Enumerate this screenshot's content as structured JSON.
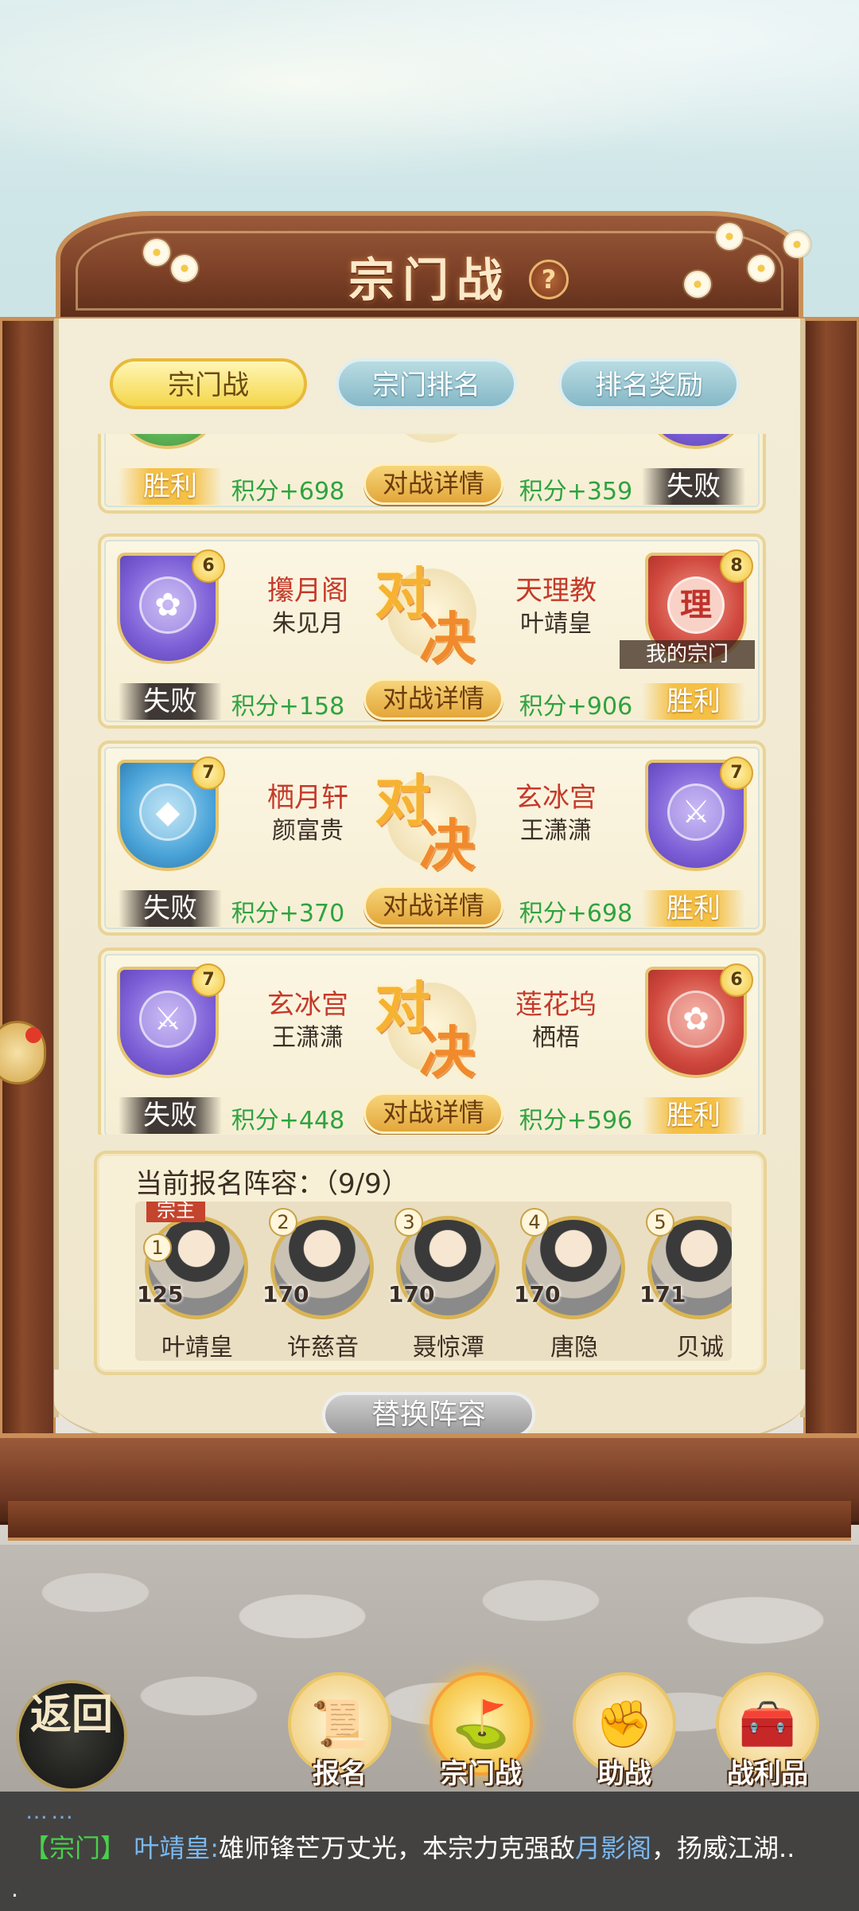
{
  "title": "宗门战",
  "help": "?",
  "tabs": [
    {
      "label": "宗门战",
      "active": true
    },
    {
      "label": "宗门排名",
      "active": false
    },
    {
      "label": "排名奖励",
      "active": false
    }
  ],
  "vs_text": [
    "对",
    "决"
  ],
  "detail_label": "对战详情",
  "my_sect_label": "我的宗门",
  "partial_match": {
    "left": {
      "result": "胜利",
      "score": "积分+698"
    },
    "right": {
      "result": "失败",
      "score": "积分+359"
    }
  },
  "matches": [
    {
      "left": {
        "sect": "攥月阁",
        "leader": "朱见月",
        "level": "6",
        "result": "失败",
        "score": "积分+158",
        "color": "purple"
      },
      "right": {
        "sect": "天理教",
        "leader": "叶靖皇",
        "level": "8",
        "result": "胜利",
        "score": "积分+906",
        "color": "red",
        "emblem_char": "理"
      }
    },
    {
      "left": {
        "sect": "栖月轩",
        "leader": "颜富贵",
        "level": "7",
        "result": "失败",
        "score": "积分+370",
        "color": "blue"
      },
      "right": {
        "sect": "玄冰宫",
        "leader": "王潇潇",
        "level": "7",
        "result": "胜利",
        "score": "积分+698",
        "color": "purple"
      }
    },
    {
      "left": {
        "sect": "玄冰宫",
        "leader": "王潇潇",
        "level": "7",
        "result": "失败",
        "score": "积分+448",
        "color": "purple"
      },
      "right": {
        "sect": "莲花坞",
        "leader": "栖梧",
        "level": "6",
        "result": "胜利",
        "score": "积分+596",
        "color": "red"
      }
    }
  ],
  "lineup": {
    "title": "当前报名阵容：（9/9）",
    "leader_tag": "宗主",
    "heroes": [
      {
        "index": "1",
        "power": "125",
        "name": "叶靖皇"
      },
      {
        "index": "2",
        "power": "170",
        "name": "许慈音"
      },
      {
        "index": "3",
        "power": "170",
        "name": "聂惊潭"
      },
      {
        "index": "4",
        "power": "170",
        "name": "唐隐"
      },
      {
        "index": "5",
        "power": "171",
        "name": "贝诚"
      }
    ]
  },
  "swap_label": "替换阵容",
  "back_label": "返回",
  "nav": [
    {
      "label": "报名",
      "icon": "scroll-brush-icon"
    },
    {
      "label": "宗门战",
      "icon": "flag-mountain-icon",
      "active": true
    },
    {
      "label": "助战",
      "icon": "handshake-icon"
    },
    {
      "label": "战利品",
      "icon": "treasure-chest-icon"
    }
  ],
  "chat": {
    "dots": "……",
    "channel": "【宗门】",
    "sender": "叶靖皇:",
    "text_before": "雄师锋芒万丈光，本宗力克强敌",
    "sect": "月影阁",
    "text_after": "，扬威江湖..",
    "tail": "."
  }
}
